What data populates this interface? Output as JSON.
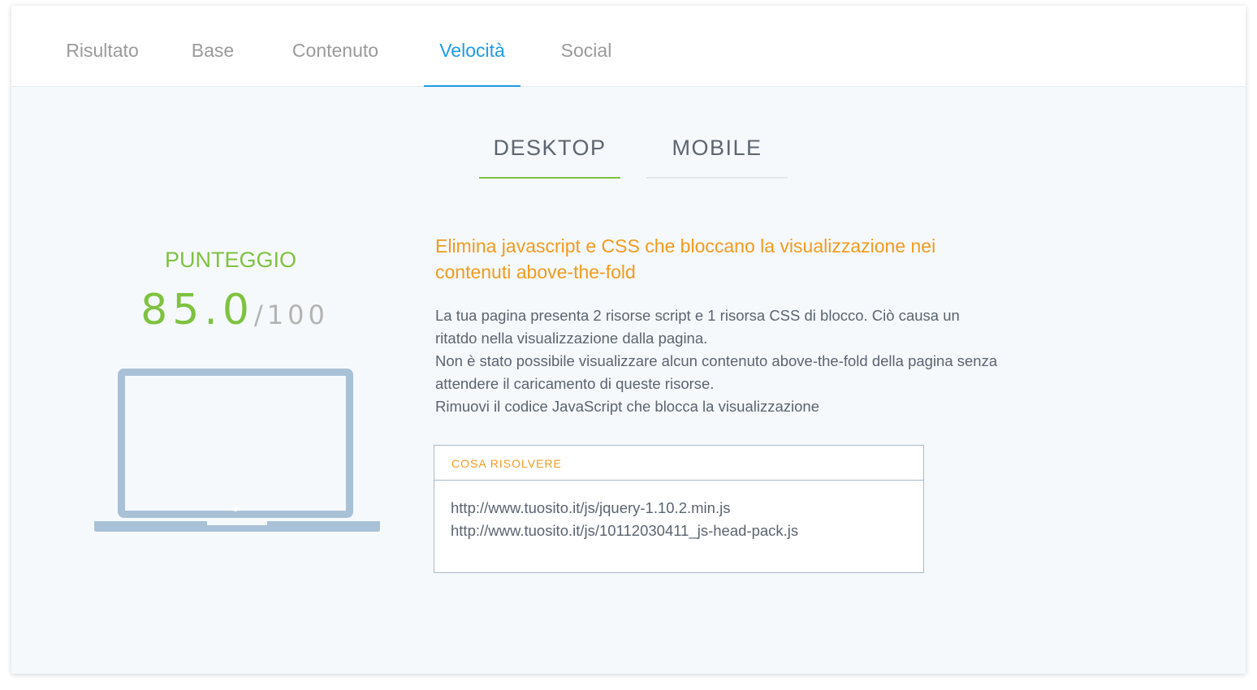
{
  "top_tabs": [
    {
      "label": "Risultato",
      "active": false
    },
    {
      "label": "Base",
      "active": false
    },
    {
      "label": "Contenuto",
      "active": false
    },
    {
      "label": "Velocità",
      "active": true
    },
    {
      "label": "Social",
      "active": false
    }
  ],
  "device_tabs": [
    {
      "label": "DESKTOP",
      "active": true
    },
    {
      "label": "MOBILE",
      "active": false
    }
  ],
  "score": {
    "label": "PUNTEGGIO",
    "value": "85.0",
    "max": "/100"
  },
  "device_icon": "laptop-icon",
  "issue": {
    "title": "Elimina javascript e CSS che bloccano la visualizzazione nei contenuti above-the-fold",
    "description": [
      "La tua pagina presenta 2 risorse script e 1 risorsa CSS di blocco. Ciò causa un ritatdo nella visualizzazione dalla pagina.",
      "Non è stato possibile visualizzare alcun contenuto above-the-fold della pagina senza attendere il caricamento di queste risorse.",
      "Rimuovi il codice JavaScript che blocca la visualizzazione"
    ],
    "fix_header": "COSA RISOLVERE",
    "fix_items": [
      "http://www.tuosito.it/js/jquery-1.10.2.min.js",
      "http://www.tuosito.it/js/10112030411_js-head-pack.js"
    ]
  },
  "colors": {
    "accent_blue": "#1e9be6",
    "score_green": "#7ec240",
    "issue_orange": "#f39a1e",
    "device_gray_blue": "#a9c1d6"
  }
}
